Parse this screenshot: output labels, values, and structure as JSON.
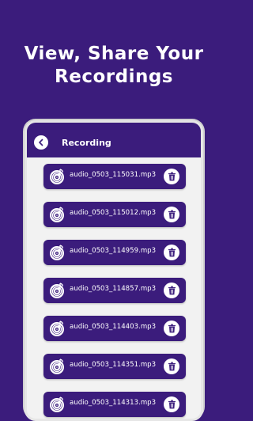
{
  "headline": {
    "line1": "View, Share Your",
    "line2": "Recordings"
  },
  "appbar": {
    "title": "Recording"
  },
  "recordings": [
    {
      "name": "audio_0503_115031.mp3"
    },
    {
      "name": "audio_0503_115012.mp3"
    },
    {
      "name": "audio_0503_114959.mp3"
    },
    {
      "name": "audio_0503_114857.mp3"
    },
    {
      "name": "audio_0503_114403.mp3"
    },
    {
      "name": "audio_0503_114351.mp3"
    },
    {
      "name": "audio_0503_114313.mp3"
    }
  ],
  "icons": {
    "back": "arrow-left-icon",
    "file": "music-disc-icon",
    "delete": "trash-icon"
  },
  "colors": {
    "brand": "#3b1c7c",
    "screen": "#f2f2f2",
    "text": "#ffffff"
  }
}
